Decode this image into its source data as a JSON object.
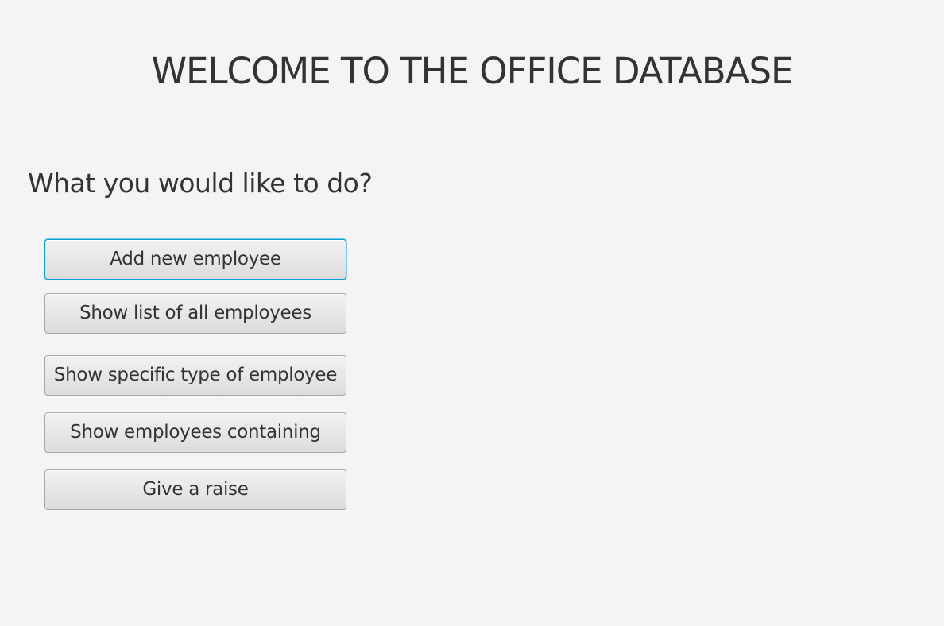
{
  "header": {
    "title": "WELCOME TO THE OFFICE DATABASE"
  },
  "main": {
    "prompt": "What you would like to do?",
    "actions": [
      {
        "label": "Add new employee",
        "focused": true
      },
      {
        "label": "Show list of all employees",
        "focused": false
      },
      {
        "label": "Show specific type of employee",
        "focused": false
      },
      {
        "label": "Show employees containing",
        "focused": false
      },
      {
        "label": "Give a raise",
        "focused": false
      }
    ]
  },
  "colors": {
    "background": "#f4f4f4",
    "text": "#333333",
    "focus_border": "#039ed3"
  }
}
